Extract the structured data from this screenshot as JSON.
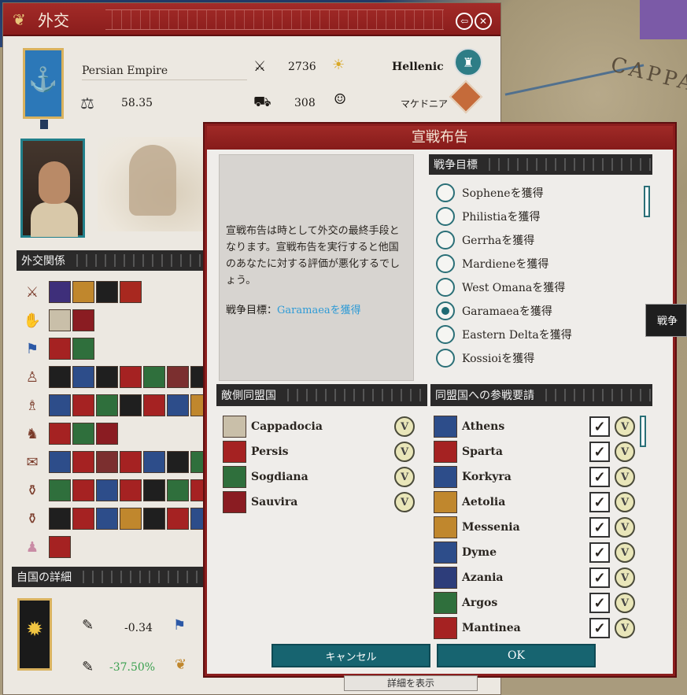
{
  "diplomacy": {
    "title": "外交",
    "faction_name": "Persian Empire",
    "score": "58.35",
    "manpower": "2736",
    "culture": "Hellenic",
    "trade": "308",
    "sub_culture": "マケドニア",
    "relations_header": "外交関係",
    "own_details_header": "自国の詳細",
    "own_values": [
      "-0.34",
      "-37.50%"
    ],
    "bottom_button": "詳細を表示"
  },
  "war": {
    "title": "宣戦布告",
    "description": "宣戦布告は時として外交の最終手段となります。宣戦布告を実行すると他国のあなたに対する評価が悪化するでしょう。",
    "goal_label": "戦争目標：",
    "goal_value": "Garamaeaを獲得",
    "goals_header": "戦争目標",
    "goals": [
      {
        "label": "Sopheneを獲得",
        "selected": false
      },
      {
        "label": "Philistiaを獲得",
        "selected": false
      },
      {
        "label": "Gerrhaを獲得",
        "selected": false
      },
      {
        "label": "Mardieneを獲得",
        "selected": false
      },
      {
        "label": "West Omanaを獲得",
        "selected": false
      },
      {
        "label": "Garamaeaを獲得",
        "selected": true
      },
      {
        "label": "Eastern Deltaを獲得",
        "selected": false
      },
      {
        "label": "Kossioiを獲得",
        "selected": false
      }
    ],
    "enemy_header": "敵側同盟国",
    "enemy_allies": [
      "Cappadocia",
      "Persis",
      "Sogdiana",
      "Sauvira"
    ],
    "call_header": "同盟国への参戦要請",
    "call_allies": [
      "Athens",
      "Sparta",
      "Korkyra",
      "Aetolia",
      "Messenia",
      "Dyme",
      "Azania",
      "Argos",
      "Mantinea"
    ],
    "cancel": "キャンセル",
    "ok": "OK"
  },
  "side_tab": "戦争",
  "check_glyph": "V",
  "tick_glyph": "✓"
}
